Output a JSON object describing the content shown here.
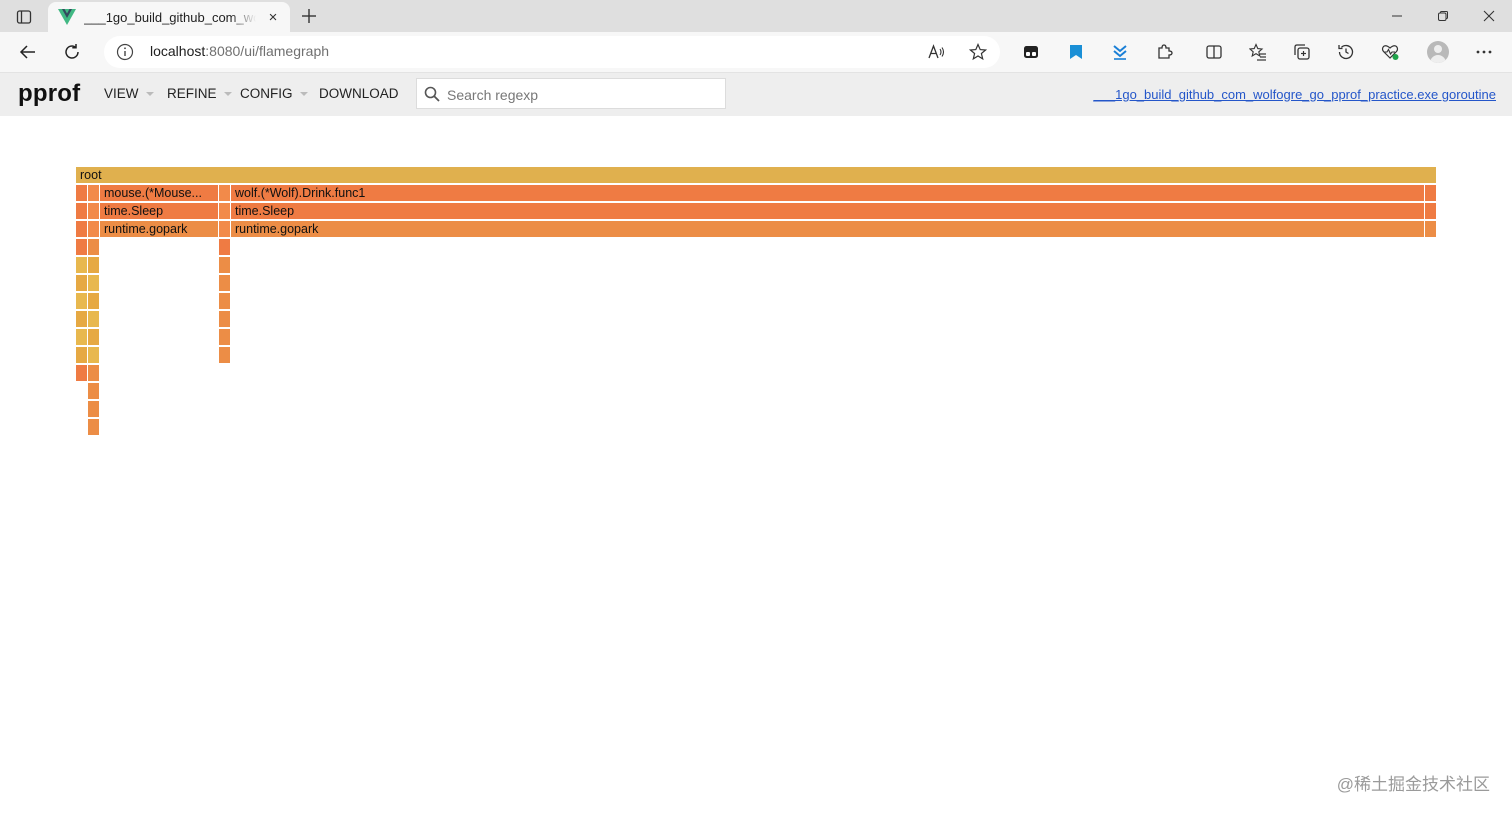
{
  "browser": {
    "tab_title": "___1go_build_github_com_wolfogre_go_pprof_practice.exe goroutine",
    "tab_close": "×",
    "url_host": "localhost",
    "url_path": ":8080/ui/flamegraph"
  },
  "app": {
    "logo": "pprof",
    "menu": {
      "view": "VIEW",
      "refine": "REFINE",
      "config": "CONFIG",
      "download": "DOWNLOAD"
    },
    "search_placeholder": "Search regexp",
    "profile_link": "___1go_build_github_com_wolfogre_go_pprof_practice.exe goroutine"
  },
  "flamegraph": {
    "root": "root",
    "frames": {
      "mouse_caller": "mouse.(*Mouse...",
      "mouse_sleep": "time.Sleep",
      "mouse_gopark": "runtime.gopark",
      "wolf_drink": "wolf.(*Wolf).Drink.func1",
      "wolf_sleep": "time.Sleep",
      "wolf_gopark": "runtime.gopark"
    }
  },
  "watermark": "@稀土掘金技术社区"
}
